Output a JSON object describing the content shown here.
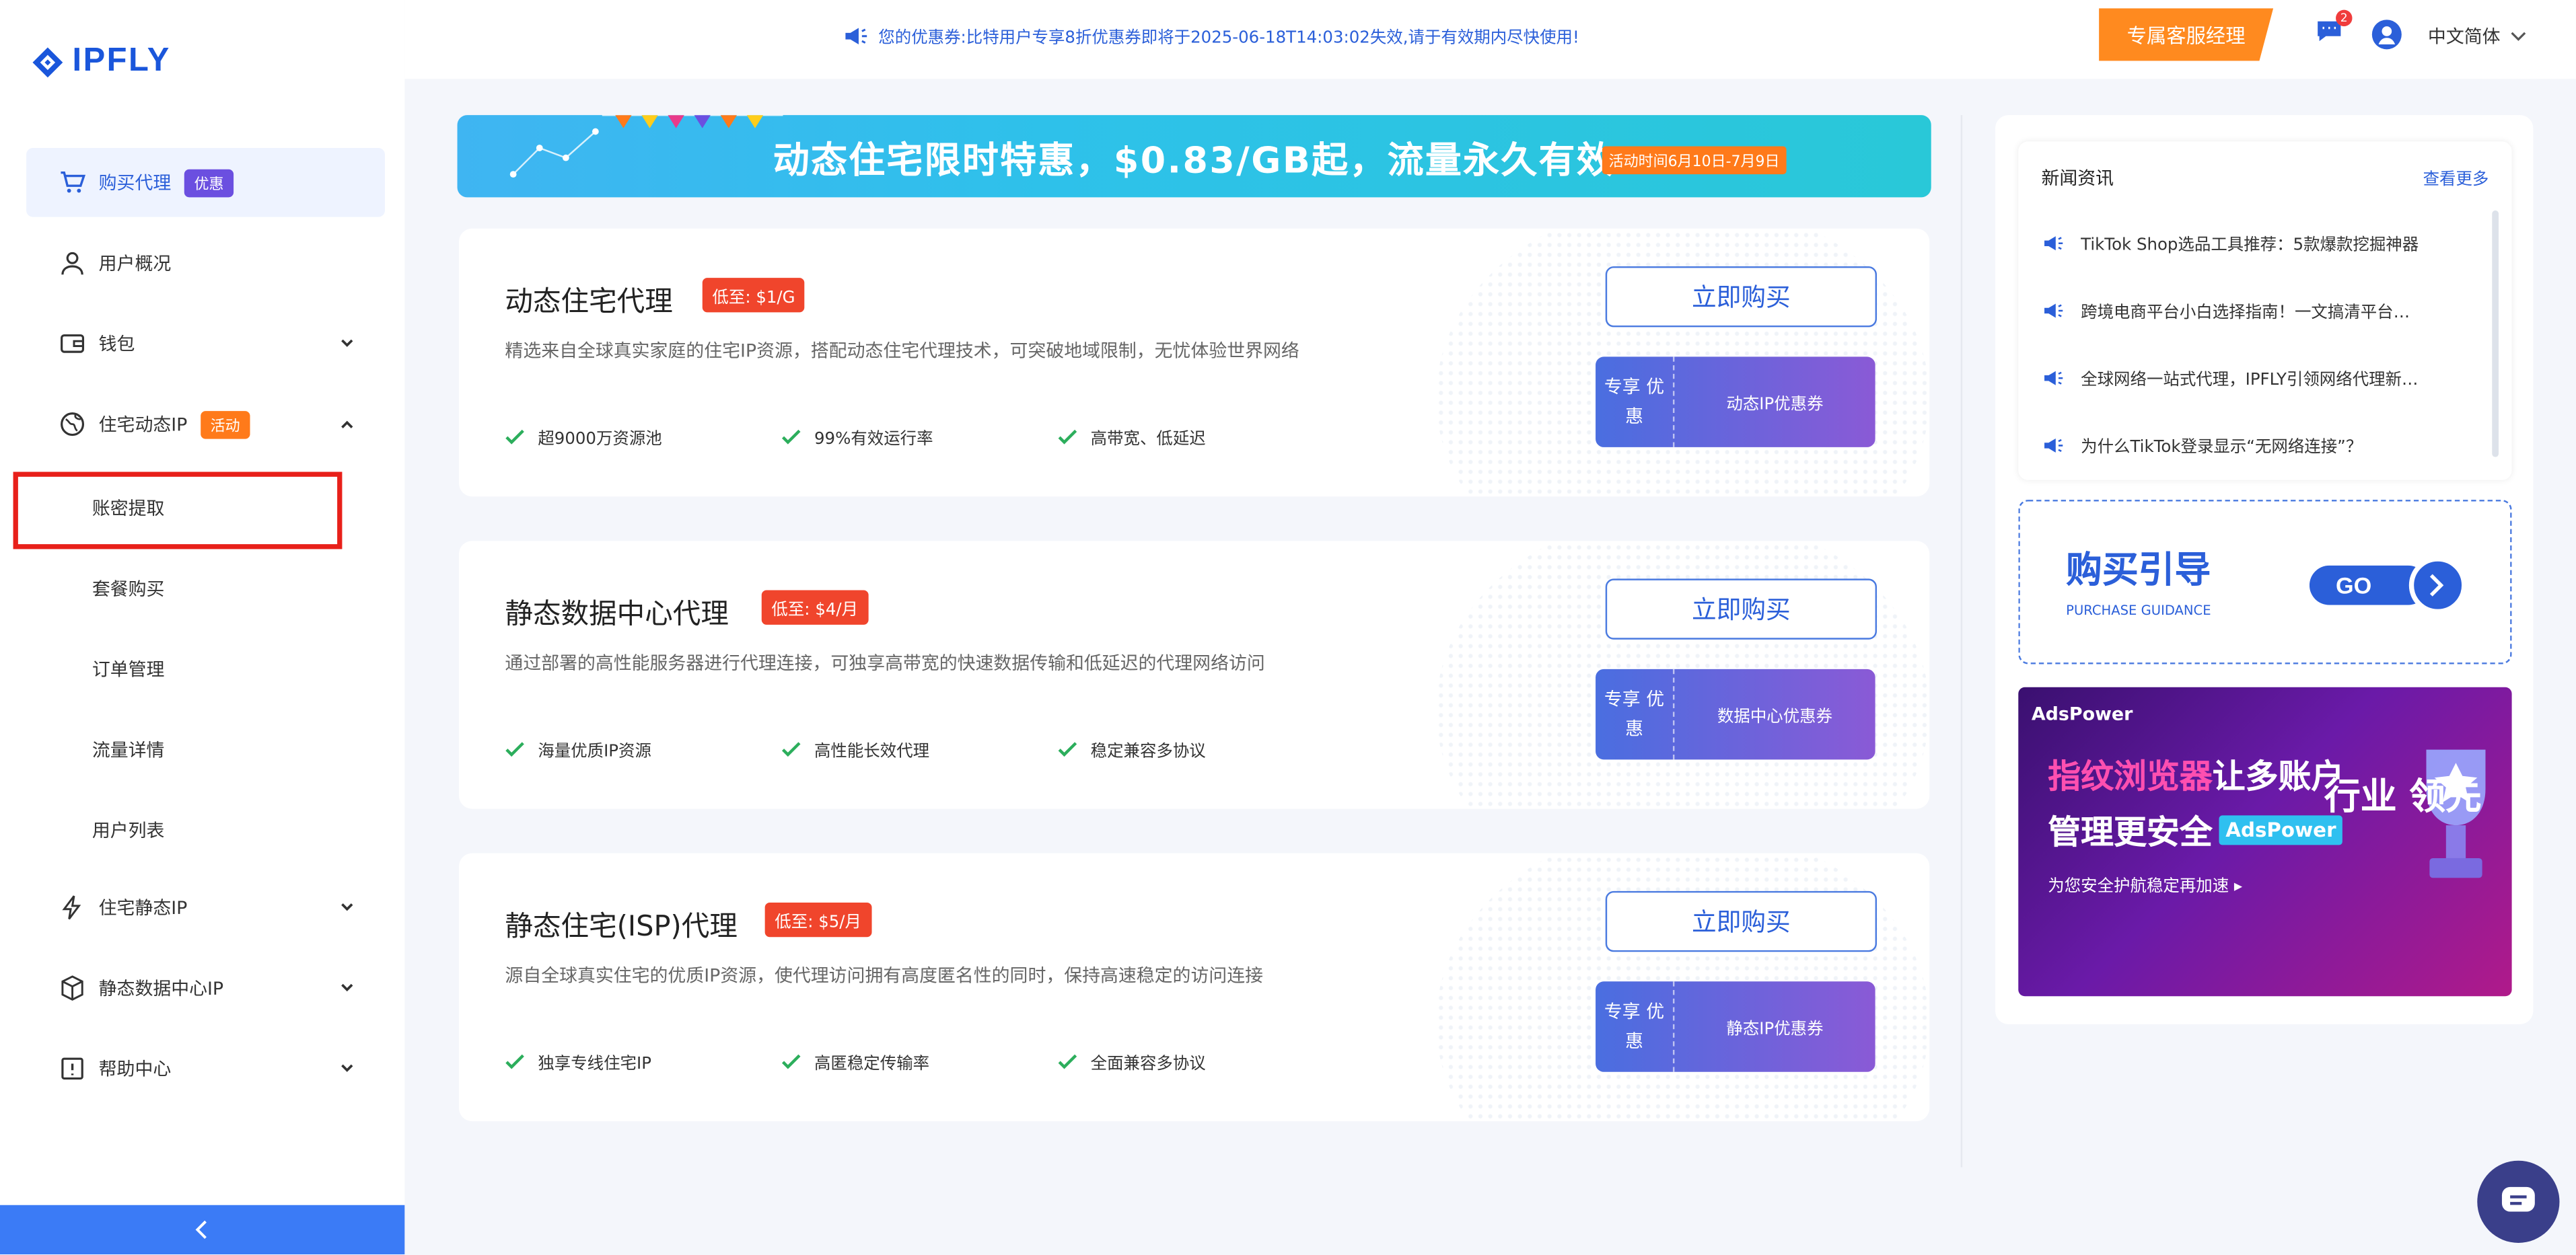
{
  "brand": {
    "name": "IPFLY"
  },
  "topbar": {
    "notice": "您的优惠券:比特用户专享8折优惠券即将于2025-06-18T14:03:02失效,请于有效期内尽快使用!",
    "manager_label": "专属客服经理",
    "msg_count": "2",
    "language": "中文简体"
  },
  "sidebar": {
    "buy_proxy": "购买代理",
    "buy_badge": "优惠",
    "user_overview": "用户概况",
    "wallet": "钱包",
    "residential_dynamic": "住宅动态IP",
    "residential_badge": "活动",
    "sub": {
      "account": "账密提取",
      "package": "套餐购买",
      "orders": "订单管理",
      "traffic": "流量详情",
      "users": "用户列表"
    },
    "residential_static": "住宅静态IP",
    "static_datacenter": "静态数据中心IP",
    "help": "帮助中心"
  },
  "banner": {
    "title": "动态住宅限时特惠，$0.83/GB起，流量永久有效!",
    "tag": "活动时间6月10日-7月9日"
  },
  "cards": [
    {
      "title": "动态住宅代理",
      "price": "低至: $1/G",
      "desc": "精选来自全球真实家庭的住宅IP资源，搭配动态住宅代理技术，可突破地域限制，无忧体验世界网络",
      "features": [
        "超9000万资源池",
        "99%有效运行率",
        "高带宽、低延迟"
      ],
      "buy": "立即购买",
      "coupon_left": "专享 优惠",
      "coupon_right": "动态IP优惠券"
    },
    {
      "title": "静态数据中心代理",
      "price": "低至: $4/月",
      "desc": "通过部署的高性能服务器进行代理连接，可独享高带宽的快速数据传输和低延迟的代理网络访问",
      "features": [
        "海量优质IP资源",
        "高性能长效代理",
        "稳定兼容多协议"
      ],
      "buy": "立即购买",
      "coupon_left": "专享 优惠",
      "coupon_right": "数据中心优惠券"
    },
    {
      "title": "静态住宅(ISP)代理",
      "price": "低至: $5/月",
      "desc": "源自全球真实住宅的优质IP资源，使代理访问拥有高度匿名性的同时，保持高速稳定的访问连接",
      "features": [
        "独享专线住宅IP",
        "高匿稳定传输率",
        "全面兼容多协议"
      ],
      "buy": "立即购买",
      "coupon_left": "专享 优惠",
      "coupon_right": "静态IP优惠券"
    }
  ],
  "news": {
    "title": "新闻资讯",
    "more": "查看更多",
    "items": [
      "TikTok Shop选品工具推荐：5款爆款挖掘神器",
      "跨境电商平台小白选择指南！一文搞清平台…",
      "全球网络一站式代理，IPFLY引领网络代理新…",
      "为什么TikTok登录显示“无网络连接”？"
    ]
  },
  "guide": {
    "title": "购买引导",
    "sub": "PURCHASE GUIDANCE",
    "go": "GO"
  },
  "ad": {
    "brand": "AdsPower",
    "line1_pink": "指纹浏览器",
    "line1_white": "让多账户",
    "line2": "管理更安全",
    "line2_chip": "AdsPower",
    "line3": "为您安全护航稳定再加速 ▸",
    "lead": "行业 领先"
  },
  "colors": {
    "primary": "#2b5fd9",
    "accent": "#ff8a1f",
    "danger": "#f0452c"
  }
}
